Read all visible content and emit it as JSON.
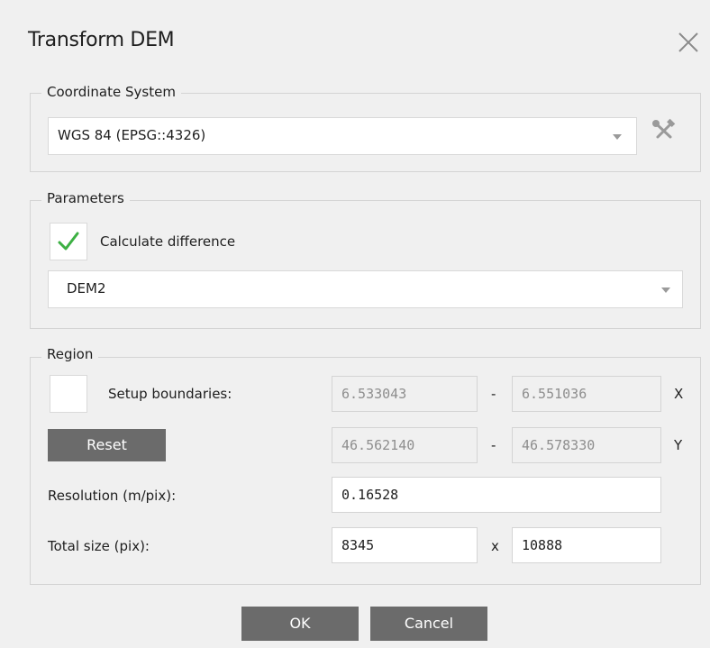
{
  "dialog": {
    "title": "Transform DEM"
  },
  "coordinate_system": {
    "label": "Coordinate System",
    "selected": "WGS 84 (EPSG::4326)"
  },
  "parameters": {
    "label": "Parameters",
    "calculate_difference": {
      "label": "Calculate difference",
      "checked": true
    },
    "dem_selected": "DEM2"
  },
  "region": {
    "label": "Region",
    "setup_boundaries": {
      "label": "Setup boundaries:",
      "checked": false
    },
    "reset_label": "Reset",
    "x_min": "6.533043",
    "x_max": "6.551036",
    "x_label": "X",
    "y_min": "46.562140",
    "y_max": "46.578330",
    "y_label": "Y",
    "range_sep": "-",
    "resolution_label": "Resolution (m/pix):",
    "resolution_value": "0.16528",
    "total_size_label": "Total size (pix):",
    "width_value": "8345",
    "size_sep": "x",
    "height_value": "10888"
  },
  "buttons": {
    "ok": "OK",
    "cancel": "Cancel"
  },
  "colors": {
    "check": "#3cb043",
    "button": "#6b6b6b",
    "border": "#d4d4d4"
  }
}
